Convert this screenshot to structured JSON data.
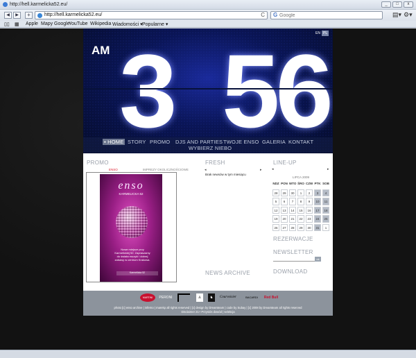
{
  "window": {
    "title": "http://hell.karmelicka52.eu/",
    "controls": [
      "_",
      "□",
      "x"
    ]
  },
  "toolbar": {
    "back": "◀",
    "forward": "▶",
    "add": "+",
    "url": "http://hell.karmelicka52.eu/",
    "reload": "C",
    "search_placeholder": "Google",
    "search_logo": "G"
  },
  "bookmarks": [
    "Apple",
    "Mapy Google",
    "YouTube",
    "Wikipedia",
    "Wiadomości ▾",
    "Popularne ▾"
  ],
  "header": {
    "lang": [
      "EN",
      "PL"
    ],
    "ampm": "AM",
    "hour": "3",
    "minute": "56"
  },
  "nav": {
    "items": [
      "▪ HOME",
      "STORY",
      "PROMO",
      "DJS AND PARTIES",
      "TWOJE ENSO",
      "GALERIA",
      "KONTAKT"
    ],
    "second_line": "WYBIERZ NIEBO"
  },
  "promo": {
    "heading": "PROMO",
    "tab_enso": "ENSO",
    "tab_events": "IMPREZY OKOLICZNOŚCIOWE",
    "poster": {
      "logo": "enso",
      "address": "KARMELICKA 52",
      "description": "Nowe miejsce przy Karmelickiej 52. Zapraszamy do świata muzyki i dobrej zabawy w centrum Krakowa.",
      "footer": "Karmelicka 52"
    }
  },
  "fresh": {
    "heading": "FRESH",
    "empty_text": "Brak newsów w tym miesiącu",
    "prev": "◂",
    "next": "▸"
  },
  "news_archive": "NEWS ARCHIVE",
  "lineup": {
    "heading": "LINE-UP",
    "month": "LIPCA 2009",
    "prev": "◂",
    "next": "▸",
    "weekdays": [
      "NDZ",
      "PON",
      "WTO",
      "ŚRO",
      "CZW",
      "PTK",
      "SOB"
    ],
    "weeks": [
      [
        "28",
        "29",
        "30",
        "1",
        "2",
        "3",
        "4"
      ],
      [
        "5",
        "6",
        "7",
        "8",
        "9",
        "10",
        "11"
      ],
      [
        "12",
        "13",
        "14",
        "15",
        "16",
        "17",
        "18"
      ],
      [
        "19",
        "20",
        "21",
        "22",
        "23",
        "24",
        "25"
      ],
      [
        "26",
        "27",
        "28",
        "29",
        "30",
        "31",
        "1"
      ]
    ],
    "highlighted": [
      "3",
      "4",
      "10",
      "11",
      "17",
      "18",
      "24",
      "25",
      "31"
    ]
  },
  "rezerwacje": "REZERWACJE",
  "newsletter": {
    "heading": "NEWSLETTER",
    "button": "ok"
  },
  "download": "DOWNLOAD",
  "sponsors": [
    "MARTINI",
    "PERONI",
    "Courvoisier",
    "BACARDI",
    "Red Bull"
  ],
  "footer": {
    "line1": "photo [c] enso archive | inferno | marekp all rights reserved | [c] design by Dreamteam | code by Subay | [c] 2008 by Dreamteam all rights reserved",
    "line2": "Disclaimer  21+ Przyniós dowód | selekcja"
  }
}
